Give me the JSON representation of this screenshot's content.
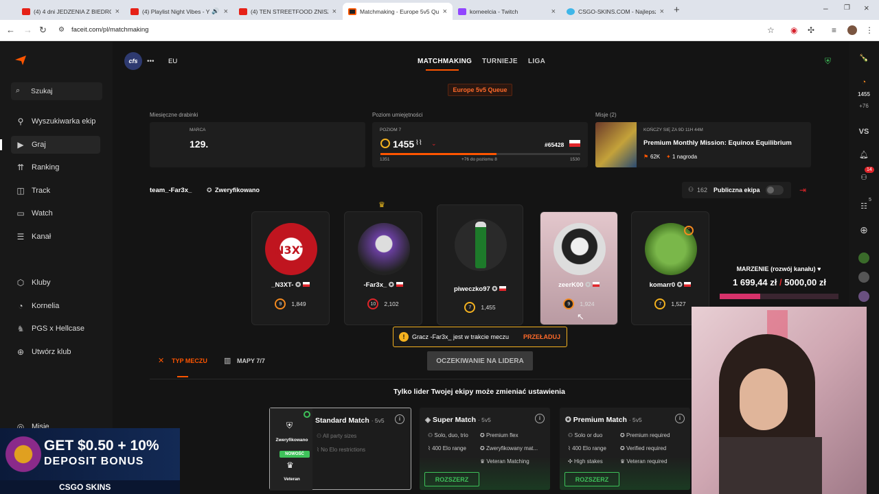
{
  "browser": {
    "tabs": [
      {
        "title": "(4) 4 dni JEDZENIA Z BIEDRONK",
        "favicon_color": "#e62117"
      },
      {
        "title": "(4) Playlist Night Vibes - Yo",
        "favicon_color": "#e62117"
      },
      {
        "title": "(4) TEN STREETFOOD ZNISZCZ",
        "favicon_color": "#e62117"
      },
      {
        "title": "Matchmaking - Europe 5v5 Qu",
        "favicon_color": "#ff5500"
      },
      {
        "title": "korneelcia - Twitch",
        "favicon_color": "#9146ff"
      },
      {
        "title": "CSGO-SKINS.COM - Najlepsze",
        "favicon_color": "#3fb6e8"
      }
    ],
    "new_tab": "+",
    "url": "faceit.com/pl/matchmaking"
  },
  "sidebar": {
    "search_placeholder": "Szukaj",
    "items": [
      {
        "label": "Wyszukiwarka ekip",
        "icon": "team-search-icon"
      },
      {
        "label": "Graj",
        "icon": "play-icon"
      },
      {
        "label": "Ranking",
        "icon": "ranking-icon"
      },
      {
        "label": "Track",
        "icon": "track-icon"
      },
      {
        "label": "Watch",
        "icon": "watch-icon"
      },
      {
        "label": "Kanał",
        "icon": "channel-icon"
      }
    ],
    "clubs": [
      {
        "label": "Kluby",
        "icon": "clubs-icon"
      },
      {
        "label": "Kornelia",
        "icon": "person-icon"
      },
      {
        "label": "PGS x Hellcase",
        "icon": "club-logo-icon"
      },
      {
        "label": "Utwórz klub",
        "icon": "plus-icon"
      }
    ],
    "missions_label": "Misje"
  },
  "header": {
    "team_badge": "cfs",
    "more": "•••",
    "region": "EU",
    "nav": [
      "MATCHMAKING",
      "TURNIEJE",
      "LIGA"
    ],
    "queue": "Europe 5v5 Queue"
  },
  "stats": {
    "monthly_label": "Miesięczne drabinki",
    "month_name": "MARCA",
    "month_rank": "129.",
    "skill_label": "Poziom umiejętności",
    "level_name": "POZIOM 7",
    "elo": "1455",
    "rank": "#65428",
    "bar_min": "1351",
    "bar_mid": "+76 do poziomu 8",
    "bar_max": "1530",
    "progress": 0.58,
    "missions_label": "Misje (2)",
    "mission_timer": "KOŃCZY SIĘ ZA 9D 11H 44M",
    "mission_title": "Premium Monthly Mission: Equinox Equilibrium",
    "mission_points": "62K",
    "mission_reward": "1 nagroda"
  },
  "party": {
    "name": "team_-Far3x_",
    "verified": "Zweryfikowano",
    "count": "162",
    "public_label": "Publiczna ekipa"
  },
  "players": [
    {
      "name": "_N3XT-",
      "level": "9",
      "elo": "1,849",
      "color": "#c0151f"
    },
    {
      "name": "-Far3x_",
      "level": "10",
      "elo": "2,102",
      "color": "#6a3fa0"
    },
    {
      "name": "piweczko97",
      "level": "7",
      "elo": "1,455",
      "color": "#2a2a2a"
    },
    {
      "name": "zeerK00",
      "level": "9",
      "elo": "1,924",
      "color": "#d9b7c0"
    },
    {
      "name": "komarr0",
      "level": "7",
      "elo": "1,527",
      "color": "#4d8c2a"
    }
  ],
  "donation": {
    "title": "MARZENIE (rozwój kanału) ♥",
    "current": "1 699,44 zł",
    "separator": "/",
    "goal": "5000,00 zł",
    "progress": 0.34
  },
  "alert": {
    "text": "Gracz -Far3x_ jest w trakcie meczu",
    "action": "PRZEŁADUJ"
  },
  "waiting_button": "OCZEKIWANIE NA LIDERA",
  "match_tabs": [
    "TYP MECZU",
    "MAPY 7/7"
  ],
  "leader_note": "Tylko lider Twojej ekipy może zmieniać ustawienia",
  "modes": [
    {
      "title": "Standard Match",
      "suffix": "· 5v5",
      "features": [
        "All party sizes",
        "No Elo restrictions"
      ],
      "left_labels": [
        "Zweryfikowano",
        "NOWOŚĆ",
        "Veteran"
      ]
    },
    {
      "title": "Super Match",
      "suffix": "· 5v5",
      "features": [
        "Solo, duo, trio",
        "400 Elo range",
        "Premium flex",
        "Zweryfikowany mat...",
        "Veteran Matching"
      ],
      "button": "ROZSZERZ"
    },
    {
      "title": "Premium Match",
      "suffix": "· 5v5",
      "features": [
        "Solo or duo",
        "400 Elo range",
        "High stakes",
        "Premium required",
        "Verified required",
        "Veteran required"
      ],
      "button": "ROZSZERZ"
    }
  ],
  "ad": {
    "line1": "GET $0.50 + 10%",
    "line2": "DEPOSIT BONUS",
    "brand": "CSGO SKINS"
  },
  "rightbar": {
    "vs": "VS",
    "elo": "1455",
    "elo_delta": "+76",
    "notif_count": "14",
    "friends_count": "5"
  },
  "colors": {
    "accent": "#ff5500",
    "green": "#3ec25a",
    "red": "#e0252a"
  }
}
